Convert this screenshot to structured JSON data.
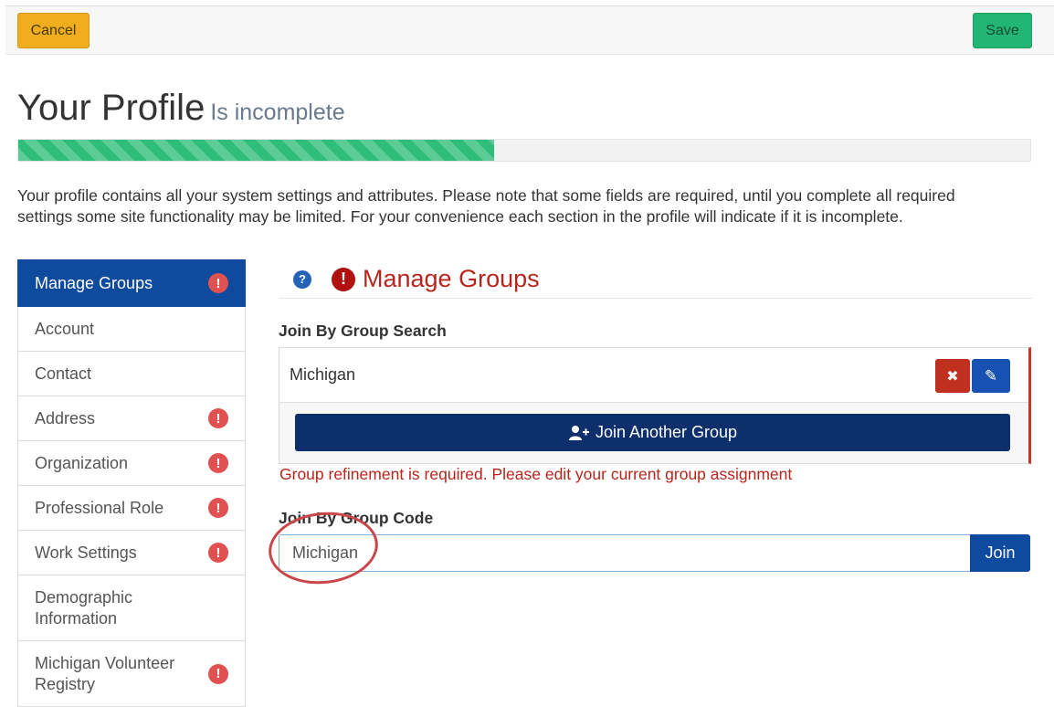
{
  "toolbar": {
    "cancel_label": "Cancel",
    "save_label": "Save"
  },
  "header": {
    "title": "Your Profile",
    "subtitle": "Is incomplete"
  },
  "progress": {
    "fraction": 0.47,
    "color": "#2fbe7a"
  },
  "intro_text": "Your profile contains all your system settings and attributes. Please note that some fields are required, until you complete all required settings some site functionality may be limited. For your convenience each section in the profile will indicate if it is incomplete.",
  "sidebar": {
    "items": [
      {
        "label": "Manage Groups",
        "active": true,
        "incomplete": true
      },
      {
        "label": "Account",
        "incomplete": false
      },
      {
        "label": "Contact",
        "incomplete": false
      },
      {
        "label": "Address",
        "incomplete": true
      },
      {
        "label": "Organization",
        "incomplete": true
      },
      {
        "label": "Professional Role",
        "incomplete": true
      },
      {
        "label": "Work Settings",
        "incomplete": true
      },
      {
        "label": "Demographic Information",
        "incomplete": false
      },
      {
        "label": "Michigan Volunteer Registry",
        "incomplete": true
      }
    ],
    "alert_glyph": "!"
  },
  "main": {
    "help_glyph": "?",
    "alert_glyph": "!",
    "title": "Manage Groups",
    "join_search": {
      "label": "Join By Group Search",
      "group_name": "Michigan",
      "remove_glyph": "✖",
      "edit_glyph": "✎",
      "join_another_label": "Join Another Group"
    },
    "error_message": "Group refinement is required. Please edit your current group assignment",
    "join_code": {
      "label": "Join By Group Code",
      "value": "Michigan",
      "button_label": "Join"
    }
  },
  "colors": {
    "primary": "#0e4a9e",
    "dark_navy": "#0d2f6b",
    "danger": "#b8251c",
    "warning": "#f0ad1e",
    "success": "#22b573"
  }
}
